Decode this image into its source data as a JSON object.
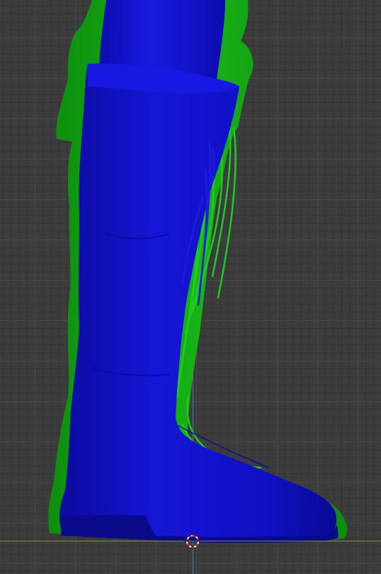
{
  "viewport": {
    "background_color": "#3d3d3d",
    "grid_major_color": "#4a4a4a",
    "grid_minor_color": "#343434",
    "x_axis_color": "#7b8d3a",
    "y_axis_color": "#4a78a6"
  },
  "scene": {
    "objects": [
      {
        "name": "boot-back-silhouette",
        "color": "#12a012"
      },
      {
        "name": "boot-front",
        "color": "#1010cc"
      },
      {
        "name": "laces-green",
        "color": "#1fbf1f"
      },
      {
        "name": "laces-blue",
        "color": "#1a1ad8"
      }
    ]
  },
  "cursor": {
    "icon": "3d-cursor-icon",
    "colors": [
      "#cc2222",
      "#ffffff"
    ]
  }
}
